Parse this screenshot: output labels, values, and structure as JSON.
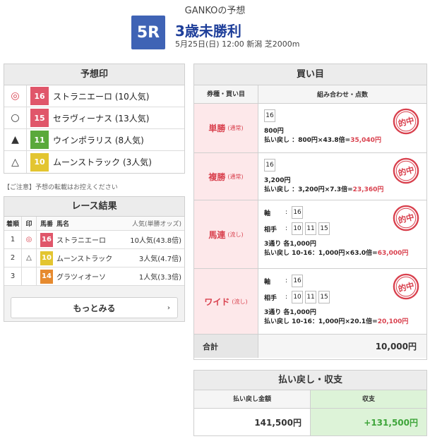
{
  "header": {
    "title": "GANKOの予想",
    "race_number": "5R",
    "race_name": "3歳未勝利",
    "race_info": "5月25日(日) 12:00 新潟 芝2000m"
  },
  "prediction": {
    "title": "予想印",
    "rows": [
      {
        "mark": "◎",
        "num": "16",
        "color": "#e0566a",
        "name": "ストラニエーロ (10人気)"
      },
      {
        "mark": "○",
        "num": "15",
        "color": "#e0566a",
        "name": "セラヴィーナス (13人気)"
      },
      {
        "mark": "▲",
        "num": "11",
        "color": "#5aa93b",
        "name": "ウインポラリス (8人気)"
      },
      {
        "mark": "△",
        "num": "10",
        "color": "#e3c530",
        "name": "ムーンストラック (3人気)"
      }
    ]
  },
  "note": "【ご注意】予想の転載はお控えください",
  "result": {
    "title": "レース結果",
    "headers": {
      "rank": "着順",
      "mark": "印",
      "num": "馬番",
      "name": "馬名",
      "pop": "人気(単勝オッズ)"
    },
    "rows": [
      {
        "rank": "1",
        "mark": "◎",
        "num": "16",
        "color": "#e0566a",
        "name": "ストラニエーロ",
        "pop": "10人気(43.8倍)"
      },
      {
        "rank": "2",
        "mark": "△",
        "num": "10",
        "color": "#e3c530",
        "name": "ムーンストラック",
        "pop": "3人気(4.7倍)"
      },
      {
        "rank": "3",
        "mark": "",
        "num": "14",
        "color": "#e68a2e",
        "name": "グラツィオーソ",
        "pop": "1人気(3.3倍)"
      }
    ],
    "more_label": "もっとみる"
  },
  "bets": {
    "title": "買い目",
    "col1": "券種・買い目",
    "col2": "組み合わせ・点数",
    "tansho": {
      "type": "単勝",
      "sub": "(通常)",
      "num": "16",
      "amount": "800円",
      "payout_prefix": "払い戻し ：800円×43.8倍=",
      "payout_value": "35,040円"
    },
    "fukusho": {
      "type": "複勝",
      "sub": "(通常)",
      "num": "16",
      "amount": "3,200円",
      "payout_prefix": "払い戻し ：3,200円×7.3倍=",
      "payout_value": "23,360円"
    },
    "umaren": {
      "type": "馬連",
      "sub": "(流し)",
      "axis_label": "軸",
      "axis": "16",
      "partner_label": "相手",
      "partners": [
        "10",
        "11",
        "15"
      ],
      "amount": "3通り 各1,000円",
      "payout_prefix": "払い戻し 10-16：1,000円×63.0倍=",
      "payout_value": "63,000円"
    },
    "wide": {
      "type": "ワイド",
      "sub": "(流し)",
      "axis_label": "軸",
      "axis": "16",
      "partner_label": "相手",
      "partners": [
        "10",
        "11",
        "15"
      ],
      "amount": "3通り 各1,000円",
      "payout_prefix": "払い戻し 10-16：1,000円×20.1倍=",
      "payout_value": "20,100円"
    },
    "stamp_text": "的中",
    "total_label": "合計",
    "total_value": "10,000円"
  },
  "payout": {
    "title": "払い戻し・収支",
    "col1": "払い戻し金額",
    "col2": "収支",
    "amount": "141,500円",
    "balance": "+131,500円"
  }
}
